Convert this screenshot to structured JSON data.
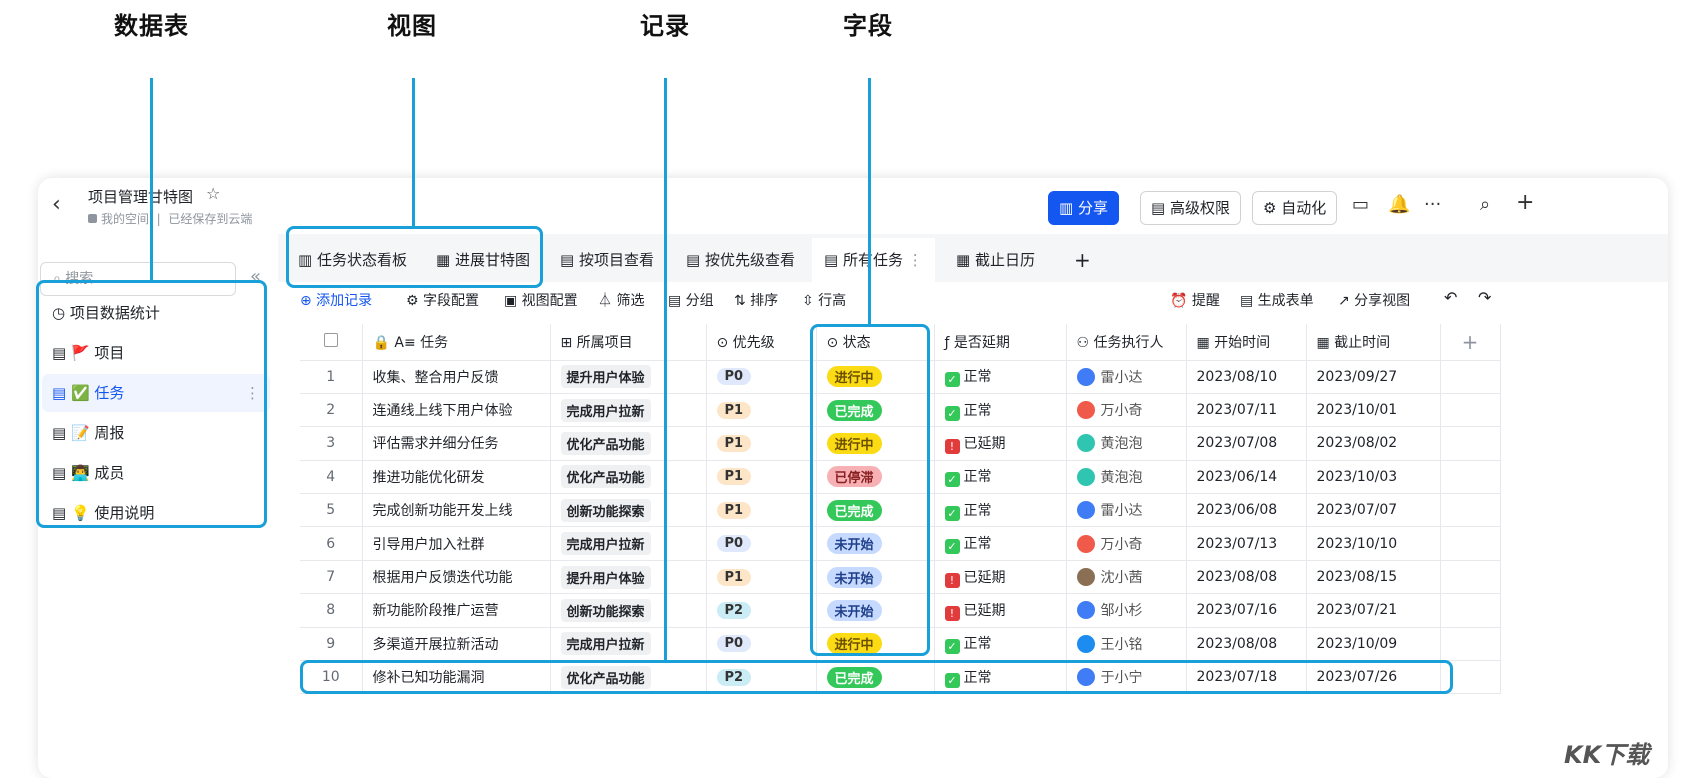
{
  "annotations": {
    "tables": "数据表",
    "views": "视图",
    "records": "记录",
    "fields": "字段"
  },
  "colors": {
    "accent": "#1456f0",
    "highlight": "#1aa0d8"
  },
  "header": {
    "back": "‹",
    "title": "项目管理甘特图",
    "star": "☆",
    "space": "我的空间",
    "saved": "已经保存到云端",
    "share": "分享",
    "permissions": "高级权限",
    "automation": "自动化",
    "more": "···",
    "search_icon": "⌕",
    "add_icon": "+"
  },
  "sidebar": {
    "search_placeholder": "搜索",
    "collapse": "«",
    "items": [
      {
        "icon": "◷",
        "label": "项目数据统计"
      },
      {
        "icon": "▤ 🚩",
        "label": "项目"
      },
      {
        "icon": "▤ ✅",
        "label": "任务"
      },
      {
        "icon": "▤ 📝",
        "label": "周报"
      },
      {
        "icon": "▤ 👨‍💻",
        "label": "成员"
      },
      {
        "icon": "▤ 💡",
        "label": "使用说明"
      }
    ]
  },
  "tabs": [
    {
      "icon": "▥",
      "label": "任务状态看板"
    },
    {
      "icon": "▦",
      "label": "进展甘特图"
    },
    {
      "icon": "▤",
      "label": "按项目查看"
    },
    {
      "icon": "▤",
      "label": "按优先级查看"
    },
    {
      "icon": "▤",
      "label": "所有任务"
    },
    {
      "icon": "▦",
      "label": "截止日历"
    },
    {
      "icon": "",
      "label": "+"
    }
  ],
  "toolbar": {
    "add": "⊕ 添加记录",
    "fields": "⚙ 字段配置",
    "view": "▣ 视图配置",
    "filter": "⏃ 筛选",
    "group": "▤ 分组",
    "sort": "⇅ 排序",
    "rowheight": "⇳ 行高",
    "remind": "⏰ 提醒",
    "form": "▤ 生成表单",
    "share_view": "↗ 分享视图",
    "undo": "↶",
    "redo": "↷"
  },
  "columns": [
    "",
    "🔒 A≡ 任务",
    "⊞ 所属项目",
    "⊙ 优先级",
    "⊙ 状态",
    "ƒ 是否延期",
    "⚇ 任务执行人",
    "▦ 开始时间",
    "▦ 截止时间",
    "+"
  ],
  "rows": [
    {
      "n": "1",
      "task": "收集、整合用户反馈",
      "proj": "提升用户体验",
      "pri": "P0",
      "status": "进行中",
      "delay": "正常",
      "owner": "雷小达",
      "start": "2023/08/10",
      "end": "2023/09/27"
    },
    {
      "n": "2",
      "task": "连通线上线下用户体验",
      "proj": "完成用户拉新",
      "pri": "P1",
      "status": "已完成",
      "delay": "正常",
      "owner": "万小奇",
      "start": "2023/07/11",
      "end": "2023/10/01"
    },
    {
      "n": "3",
      "task": "评估需求并细分任务",
      "proj": "优化产品功能",
      "pri": "P1",
      "status": "进行中",
      "delay": "已延期",
      "owner": "黄泡泡",
      "start": "2023/07/08",
      "end": "2023/08/02"
    },
    {
      "n": "4",
      "task": "推进功能优化研发",
      "proj": "优化产品功能",
      "pri": "P1",
      "status": "已停滞",
      "delay": "正常",
      "owner": "黄泡泡",
      "start": "2023/06/14",
      "end": "2023/10/03"
    },
    {
      "n": "5",
      "task": "完成创新功能开发上线",
      "proj": "创新功能探索",
      "pri": "P1",
      "status": "已完成",
      "delay": "正常",
      "owner": "雷小达",
      "start": "2023/06/08",
      "end": "2023/07/07"
    },
    {
      "n": "6",
      "task": "引导用户加入社群",
      "proj": "完成用户拉新",
      "pri": "P0",
      "status": "未开始",
      "delay": "正常",
      "owner": "万小奇",
      "start": "2023/07/13",
      "end": "2023/10/10"
    },
    {
      "n": "7",
      "task": "根据用户反馈迭代功能",
      "proj": "提升用户体验",
      "pri": "P1",
      "status": "未开始",
      "delay": "已延期",
      "owner": "沈小茜",
      "start": "2023/08/08",
      "end": "2023/08/15"
    },
    {
      "n": "8",
      "task": "新功能阶段推广运营",
      "proj": "创新功能探索",
      "pri": "P2",
      "status": "未开始",
      "delay": "已延期",
      "owner": "邹小杉",
      "start": "2023/07/16",
      "end": "2023/07/21"
    },
    {
      "n": "9",
      "task": "多渠道开展拉新活动",
      "proj": "完成用户拉新",
      "pri": "P0",
      "status": "进行中",
      "delay": "正常",
      "owner": "王小铭",
      "start": "2023/08/08",
      "end": "2023/10/09"
    },
    {
      "n": "10",
      "task": "修补已知功能漏洞",
      "proj": "优化产品功能",
      "pri": "P2",
      "status": "已完成",
      "delay": "正常",
      "owner": "于小宁",
      "start": "2023/07/18",
      "end": "2023/07/26"
    }
  ],
  "pri_colors": {
    "P0": "#dfe9fb",
    "P1": "#fde6c8",
    "P2": "#c9ecf5"
  },
  "status_colors": {
    "进行中": "#fadb14",
    "已完成": "#34c759",
    "已停滞": "#f7b1b4",
    "未开始": "#c6d9ff"
  },
  "status_text": {
    "进行中": "#6b4f00",
    "已完成": "#ffffff",
    "已停滞": "#8a1f22",
    "未开始": "#1e3f8a"
  },
  "delay_colors": {
    "正常": "#34c759",
    "已延期": "#e23b3b"
  },
  "owner_colors": {
    "雷小达": "#3f7cf6",
    "万小奇": "#f05a4a",
    "黄泡泡": "#2fc5b0",
    "沈小茜": "#8b6f55",
    "邹小杉": "#3f7cf6",
    "王小铭": "#1c8cf0",
    "于小宁": "#3f7cf6"
  },
  "watermark": "KK下载"
}
